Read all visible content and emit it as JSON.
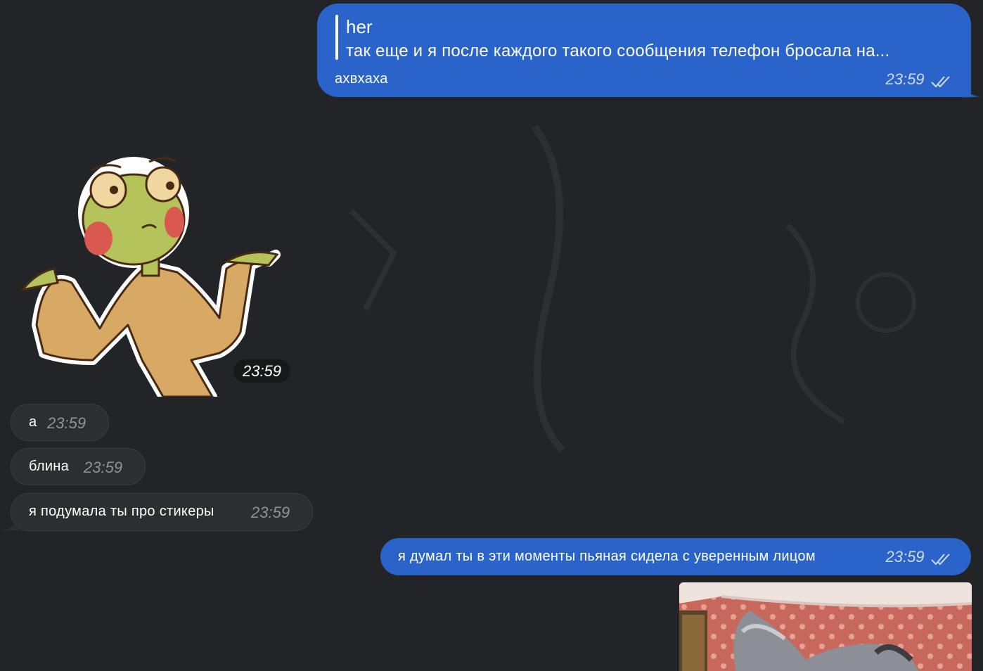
{
  "messages": {
    "m1": {
      "reply_author": "her",
      "reply_text": "так еще и я после каждого такого сообщения телефон бросала на...",
      "text": "ахвхаха",
      "time": "23:59"
    },
    "sticker": {
      "time": "23:59",
      "icon": "frog-shrug-sticker"
    },
    "m2": {
      "text": "а",
      "time": "23:59"
    },
    "m3": {
      "text": "блина",
      "time": "23:59"
    },
    "m4": {
      "text": "я подумала ты про стикеры",
      "time": "23:59"
    },
    "m5": {
      "text": "я думал ты в эти моменты пьяная сидела с уверенным лицом",
      "time": "23:59"
    },
    "photo": {
      "icon": "cat-photo"
    }
  },
  "colors": {
    "background": "#222427",
    "outgoing_bubble": "#2a63c9",
    "incoming_bubble": "#2c2e31"
  }
}
